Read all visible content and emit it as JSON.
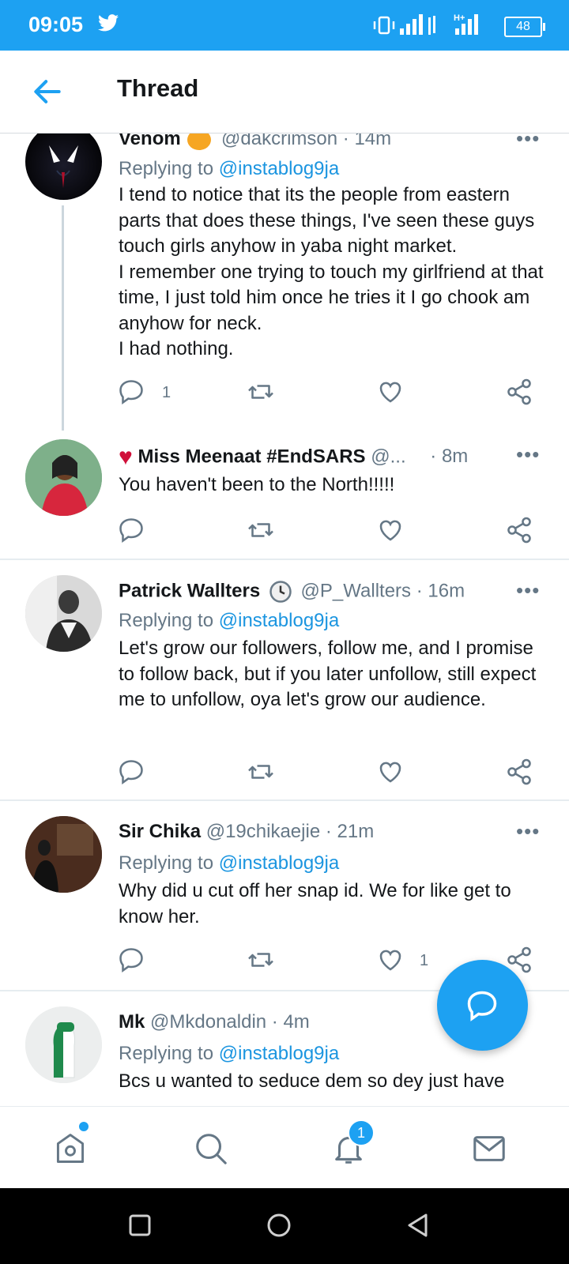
{
  "status_bar": {
    "time": "09:05",
    "battery": "48"
  },
  "header": {
    "title": "Thread"
  },
  "tweets": [
    {
      "name": "Venom",
      "handle": "@dakcrimson",
      "time": "· 14m",
      "replying_prefix": "Replying to",
      "replying_to": "@instablog9ja",
      "text": "I tend to notice that its the people from eastern parts that does these things, I've seen these guys touch girls anyhow in yaba night market.\nI remember one trying to touch my girlfriend at that time, I just told him once he tries it I go chook am anyhow for neck.\nI had nothing.",
      "reply_count": "1",
      "retweet_count": "",
      "like_count": ""
    },
    {
      "name": "Miss Meenaat #EndSARS",
      "handle": "@...",
      "time": "· 8m",
      "text": "You haven't been to the North!!!!!",
      "reply_count": "",
      "retweet_count": "",
      "like_count": ""
    },
    {
      "name": "Patrick Wallters",
      "handle": "@P_Wallters",
      "time": "· 16m",
      "replying_prefix": "Replying to",
      "replying_to": "@instablog9ja",
      "text": "Let's grow our followers, follow me, and I promise to follow back, but if you later unfollow, still expect me to unfollow, oya let's grow our audience.",
      "reply_count": "",
      "retweet_count": "",
      "like_count": ""
    },
    {
      "name": "Sir Chika",
      "handle": "@19chikaejie",
      "time": "· 21m",
      "replying_prefix": "Replying to",
      "replying_to": "@instablog9ja",
      "text": "Why did u cut off her snap id. We for like get to know her.",
      "reply_count": "",
      "retweet_count": "",
      "like_count": "1"
    },
    {
      "name": "Mk",
      "handle": "@Mkdonaldin",
      "time": "· 4m",
      "replying_prefix": "Replying to",
      "replying_to": "@instablog9ja",
      "text": "Bcs u wanted to seduce dem so dey just have"
    }
  ],
  "more_glyph": "•••",
  "bottom_nav": {
    "notifications_badge": "1"
  },
  "colors": {
    "accent": "#1da1f2",
    "link": "#1b95e0",
    "muted": "#657786",
    "text": "#14171a",
    "divider": "#e6ecf0"
  },
  "icons": [
    "twitter-bird-icon",
    "vibrate-icon",
    "signal-icon",
    "back-arrow-icon",
    "more-icon",
    "reply-icon",
    "retweet-icon",
    "like-icon",
    "share-icon",
    "compose-icon",
    "home-icon",
    "search-icon",
    "bell-icon",
    "mail-icon",
    "square-icon",
    "circle-icon",
    "triangle-back-icon"
  ]
}
